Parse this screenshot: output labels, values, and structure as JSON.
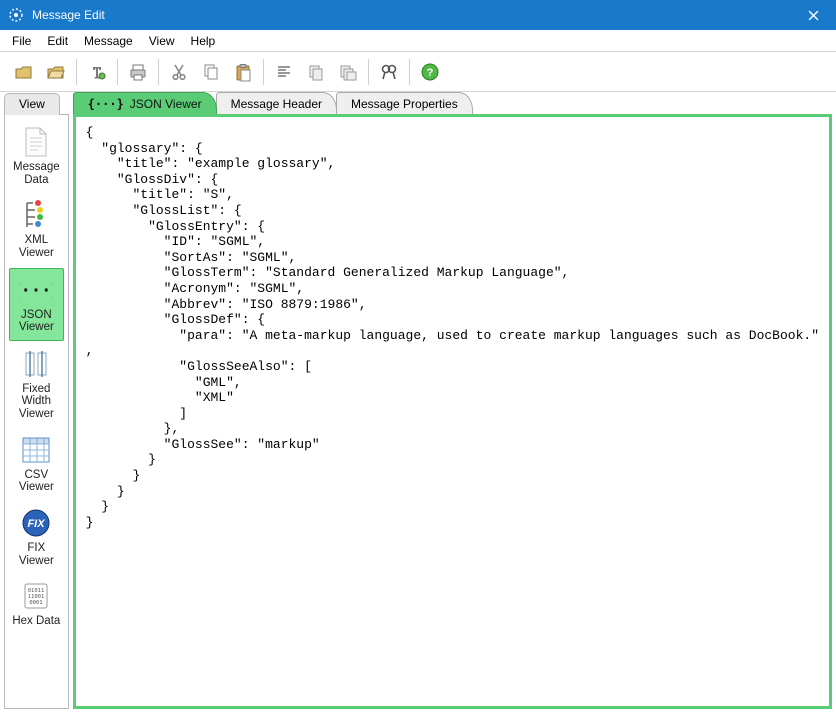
{
  "window": {
    "title": "Message Edit"
  },
  "menubar": {
    "items": [
      "File",
      "Edit",
      "Message",
      "View",
      "Help"
    ]
  },
  "toolbar": {
    "buttons": [
      "open-file-1",
      "open-file-2",
      "_sep",
      "text-tool",
      "_sep",
      "print",
      "_sep",
      "cut",
      "copy",
      "paste",
      "_sep",
      "align",
      "indent-left",
      "indent-right",
      "_sep",
      "binoculars",
      "_sep",
      "help"
    ]
  },
  "sidebar": {
    "tab_label": "View",
    "items": [
      {
        "label": "Message Data",
        "icon": "document"
      },
      {
        "label": "XML Viewer",
        "icon": "xml"
      },
      {
        "label": "JSON Viewer",
        "icon": "json",
        "selected": true
      },
      {
        "label": "Fixed Width Viewer",
        "icon": "fixedwidth"
      },
      {
        "label": "CSV Viewer",
        "icon": "csv"
      },
      {
        "label": "FIX Viewer",
        "icon": "fix"
      },
      {
        "label": "Hex Data",
        "icon": "hex"
      }
    ]
  },
  "tabs": {
    "items": [
      {
        "label": "JSON Viewer",
        "icon": "json-braces",
        "active": true
      },
      {
        "label": "Message Header",
        "active": false
      },
      {
        "label": "Message Properties",
        "active": false
      }
    ]
  },
  "content": {
    "json_text": "{\n  \"glossary\": {\n    \"title\": \"example glossary\",\n    \"GlossDiv\": {\n      \"title\": \"S\",\n      \"GlossList\": {\n        \"GlossEntry\": {\n          \"ID\": \"SGML\",\n          \"SortAs\": \"SGML\",\n          \"GlossTerm\": \"Standard Generalized Markup Language\",\n          \"Acronym\": \"SGML\",\n          \"Abbrev\": \"ISO 8879:1986\",\n          \"GlossDef\": {\n            \"para\": \"A meta-markup language, used to create markup languages such as DocBook.\"\n,\n            \"GlossSeeAlso\": [\n              \"GML\",\n              \"XML\"\n            ]\n          },\n          \"GlossSee\": \"markup\"\n        }\n      }\n    }\n  }\n}"
  }
}
